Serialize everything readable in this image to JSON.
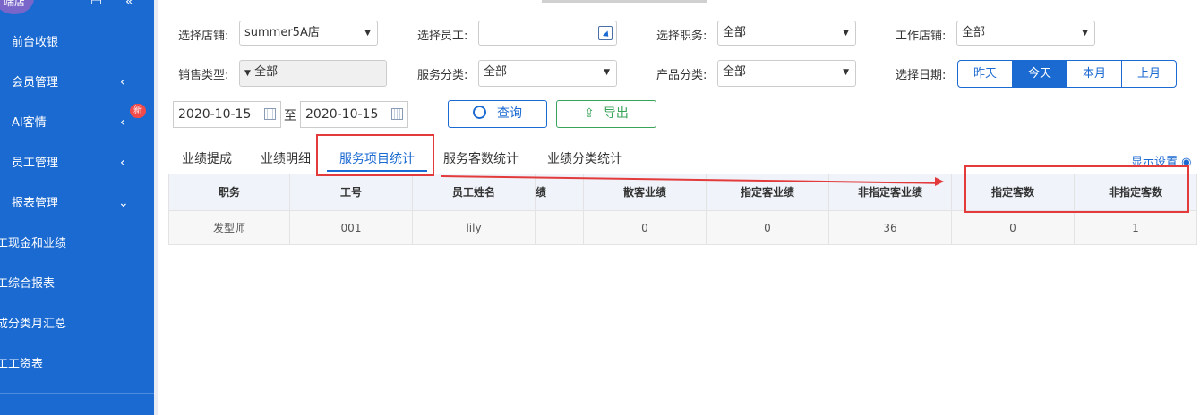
{
  "sidebar": {
    "logo_text": "端店",
    "menu": [
      {
        "label": "前台收银",
        "has_chevron": false
      },
      {
        "label": "会员管理",
        "has_chevron": true,
        "chevron": "<"
      },
      {
        "label": "AI客情",
        "has_chevron": true,
        "chevron": "<",
        "badge": "新"
      },
      {
        "label": "员工管理",
        "has_chevron": true,
        "chevron": "<"
      },
      {
        "label": "报表管理",
        "has_chevron": true,
        "chevron": "v"
      }
    ],
    "submenu": [
      "工现金和业绩",
      "工综合报表",
      "成分类月汇总",
      "工工资表"
    ]
  },
  "filters": {
    "store": {
      "label": "选择店铺:",
      "value": "summer5A店"
    },
    "employee": {
      "label": "选择员工:",
      "value": ""
    },
    "position": {
      "label": "选择职务:",
      "value": "全部"
    },
    "work_store": {
      "label": "工作店铺:",
      "value": "全部"
    },
    "sales_type": {
      "label": "销售类型:",
      "value": "全部"
    },
    "service_category": {
      "label": "服务分类:",
      "value": "全部"
    },
    "product_category": {
      "label": "产品分类:",
      "value": "全部"
    },
    "date": {
      "label": "选择日期:",
      "options": [
        "昨天",
        "今天",
        "本月",
        "上月"
      ],
      "selected": "今天"
    },
    "date_from": "2020-10-15",
    "date_to": "2020-10-15",
    "date_sep": "至",
    "query_label": "查询",
    "export_label": "导出"
  },
  "tabs": [
    "业绩提成",
    "业绩明细",
    "服务项目统计",
    "服务客数统计",
    "业绩分类统计"
  ],
  "active_tab": "服务项目统计",
  "display_settings": "显示设置",
  "table": {
    "headers": [
      "职务",
      "工号",
      "员工姓名",
      "绩",
      "散客业绩",
      "指定客业绩",
      "非指定客业绩",
      "指定客数",
      "非指定客数"
    ],
    "rows": [
      [
        "发型师",
        "001",
        "lily",
        "",
        "0",
        "0",
        "36",
        "0",
        "1"
      ]
    ]
  },
  "colors": {
    "sidebar": "#1b6ad1",
    "accent": "#1b6ad1",
    "annotation": "#e33b3b",
    "export": "#3aa35a"
  }
}
